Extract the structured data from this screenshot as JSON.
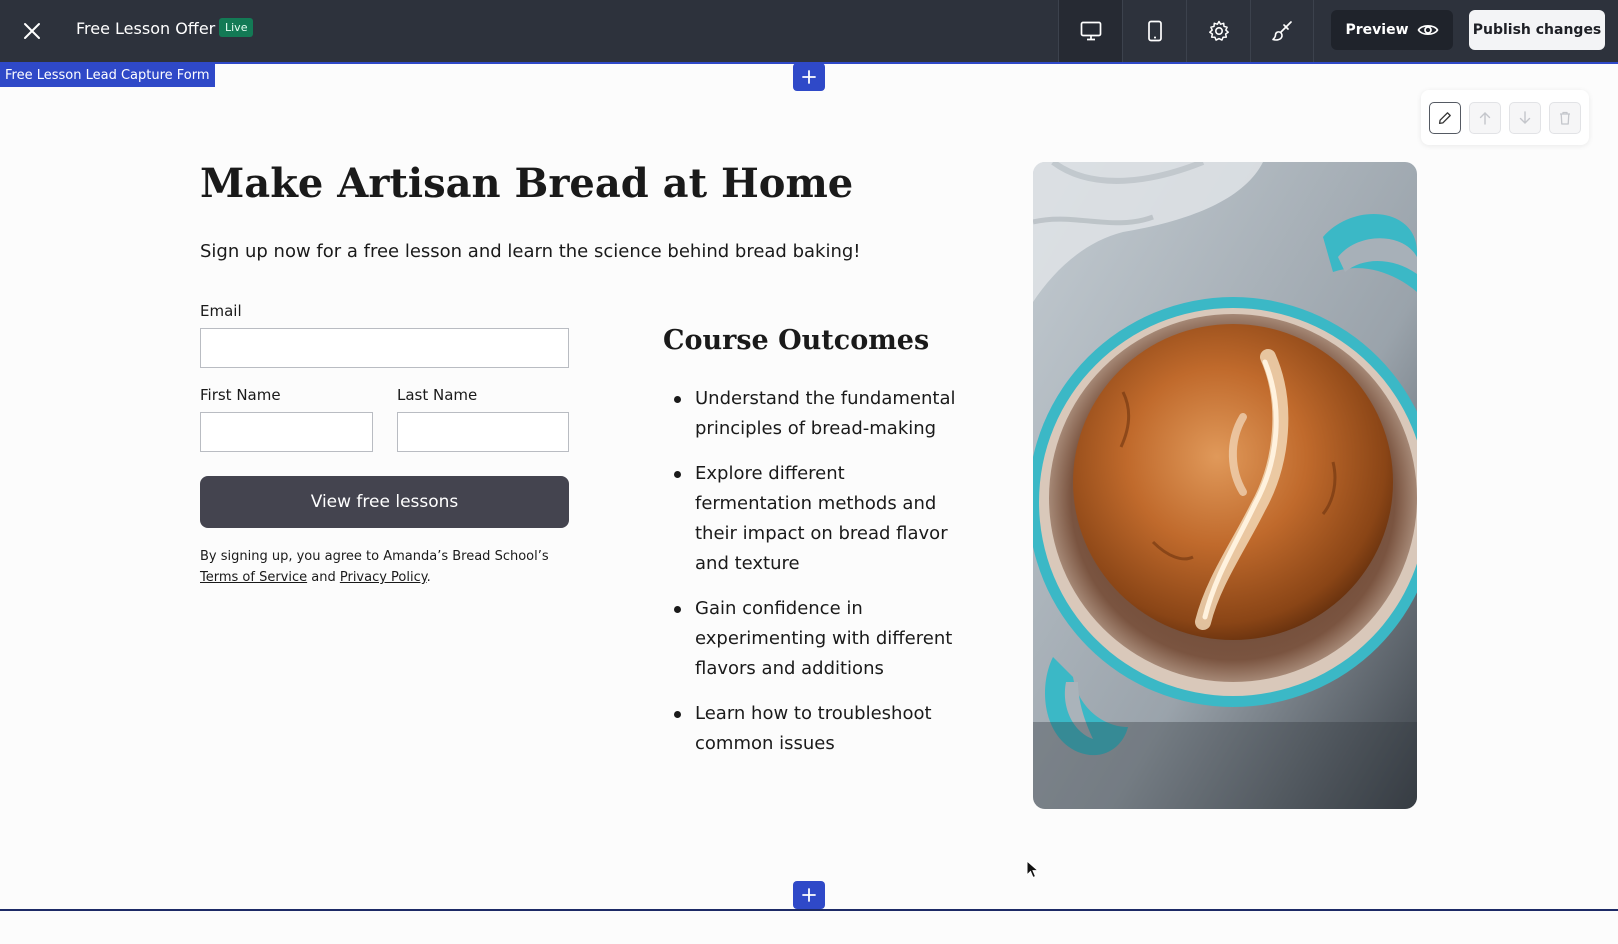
{
  "topbar": {
    "page_name": "Free Lesson Offer",
    "status_badge": "Live",
    "preview_label": "Preview",
    "publish_label": "Publish changes"
  },
  "section": {
    "label": "Free Lesson Lead Capture Form"
  },
  "content": {
    "headline": "Make Artisan Bread at Home",
    "subhead": "Sign up now for a free lesson and learn the science behind bread baking!"
  },
  "form": {
    "email_label": "Email",
    "email_value": "",
    "first_name_label": "First Name",
    "first_name_value": "",
    "last_name_label": "Last Name",
    "last_name_value": "",
    "submit_label": "View free lessons",
    "legal_prefix": "By signing up, you agree to Amanda’s Bread School’s ",
    "terms_link": "Terms of Service",
    "legal_and": " and ",
    "privacy_link": "Privacy Policy",
    "legal_suffix": "."
  },
  "outcomes": {
    "title": "Course Outcomes",
    "items": [
      "Understand the fundamental principles of bread-making",
      "Explore different fermentation methods and their impact on bread flavor and texture",
      "Gain confidence in experimenting with different flavors and additions",
      "Learn how to troubleshoot common issues"
    ]
  },
  "colors": {
    "topbar_bg": "#2d323c",
    "selection_blue": "#2f49c8",
    "live_badge": "#137a55",
    "cta_bg": "#44444f",
    "pot_teal": "#3bb8c6",
    "crust_brown": "#b5652a"
  },
  "icons": {
    "close": "close-icon",
    "desktop": "desktop-icon",
    "mobile": "mobile-icon",
    "settings": "gear-icon",
    "style": "paintbrush-icon",
    "preview": "eye-icon",
    "add": "plus-icon",
    "edit": "pencil-icon",
    "move_up": "arrow-up-icon",
    "move_down": "arrow-down-icon",
    "delete": "trash-icon"
  }
}
